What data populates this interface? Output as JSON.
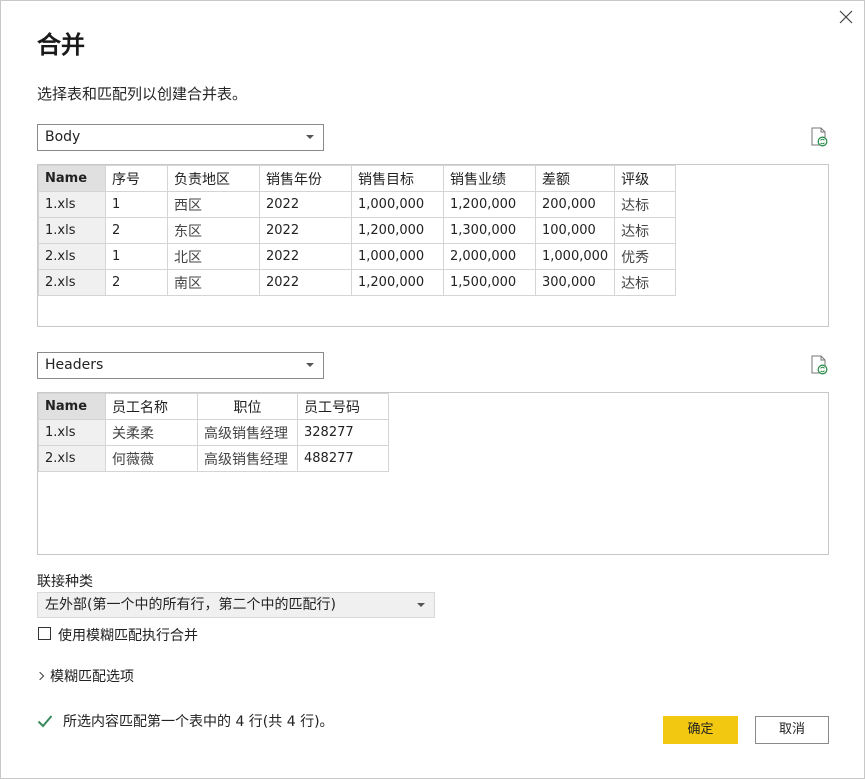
{
  "dialog": {
    "title": "合并",
    "subtitle": "选择表和匹配列以创建合并表。"
  },
  "table1": {
    "selected": "Body",
    "columns": [
      "Name",
      "序号",
      "负责地区",
      "销售年份",
      "销售目标",
      "销售业绩",
      "差额",
      "评级"
    ],
    "rows": [
      [
        "1.xls",
        "1",
        "西区",
        "2022",
        "1,000,000",
        "1,200,000",
        "200,000",
        "达标"
      ],
      [
        "1.xls",
        "2",
        "东区",
        "2022",
        "1,200,000",
        "1,300,000",
        "100,000",
        "达标"
      ],
      [
        "2.xls",
        "1",
        "北区",
        "2022",
        "1,000,000",
        "2,000,000",
        "1,000,000",
        "优秀"
      ],
      [
        "2.xls",
        "2",
        "南区",
        "2022",
        "1,200,000",
        "1,500,000",
        "300,000",
        "达标"
      ]
    ]
  },
  "table2": {
    "selected": "Headers",
    "columns": [
      "Name",
      "员工名称",
      "职位",
      "员工号码"
    ],
    "rows": [
      [
        "1.xls",
        "关柔柔",
        "高级销售经理",
        "328277"
      ],
      [
        "2.xls",
        "何薇薇",
        "高级销售经理",
        "488277"
      ]
    ]
  },
  "join": {
    "label": "联接种类",
    "selected": "左外部(第一个中的所有行，第二个中的匹配行)"
  },
  "fuzzy": {
    "checkbox_label": "使用模糊匹配执行合并",
    "checked": false,
    "options_label": "模糊匹配选项"
  },
  "status": {
    "text": "所选内容匹配第一个表中的 4 行(共 4 行)。"
  },
  "buttons": {
    "ok": "确定",
    "cancel": "取消"
  },
  "colors": {
    "accent": "#f2c811",
    "check": "#3a8a5c",
    "refresh": "#2f8f4e"
  }
}
